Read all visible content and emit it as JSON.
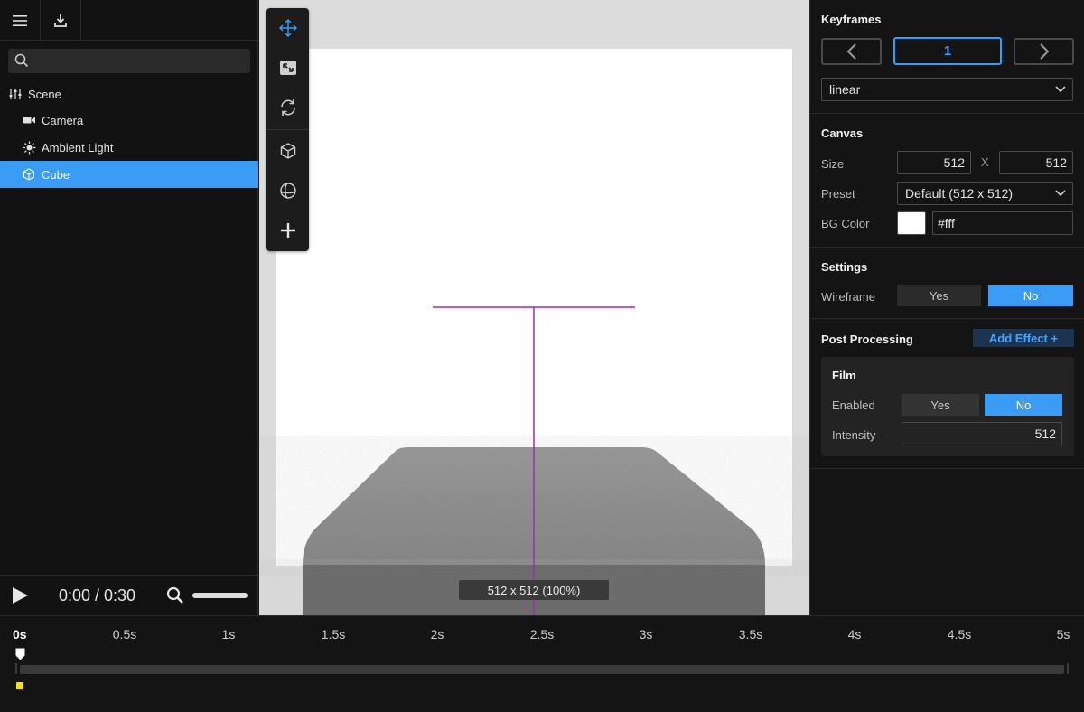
{
  "sidebar": {
    "search_placeholder": "",
    "tree": [
      {
        "label": "Scene",
        "icon": "sliders-icon"
      },
      {
        "label": "Camera",
        "icon": "video-camera-icon"
      },
      {
        "label": "Ambient Light",
        "icon": "sun-icon"
      },
      {
        "label": "Cube",
        "icon": "cube-icon",
        "selected": true
      }
    ]
  },
  "playback": {
    "time": "0:00 / 0:30"
  },
  "viewport": {
    "size_label": "512 x 512 (100%)",
    "tools": [
      "move-icon",
      "scale-icon",
      "rotate-icon",
      "cube-icon",
      "sphere-icon",
      "add-icon"
    ]
  },
  "inspector": {
    "keyframes": {
      "title": "Keyframes",
      "current": "1",
      "easing": "linear"
    },
    "canvas": {
      "title": "Canvas",
      "size_label": "Size",
      "width": "512",
      "x_sep": "X",
      "height": "512",
      "preset_label": "Preset",
      "preset": "Default (512 x 512)",
      "bg_label": "BG Color",
      "bg_value": "#fff",
      "bg_swatch": "#ffffff"
    },
    "settings": {
      "title": "Settings",
      "wireframe_label": "Wireframe",
      "yes": "Yes",
      "no": "No",
      "wireframe_value": "No"
    },
    "post": {
      "title": "Post Processing",
      "add_effect": "Add Effect +",
      "film": {
        "title": "Film",
        "enabled_label": "Enabled",
        "yes": "Yes",
        "no": "No",
        "enabled_value": "No",
        "intensity_label": "Intensity",
        "intensity": "512"
      }
    }
  },
  "timeline": {
    "ticks": [
      "0s",
      "0.5s",
      "1s",
      "1.5s",
      "2s",
      "2.5s",
      "3s",
      "3.5s",
      "4s",
      "4.5s",
      "5s"
    ]
  },
  "colors": {
    "accent": "#3b9cf5",
    "keyframe": "#f2e40a",
    "gizmo": "#9b2fa8"
  }
}
